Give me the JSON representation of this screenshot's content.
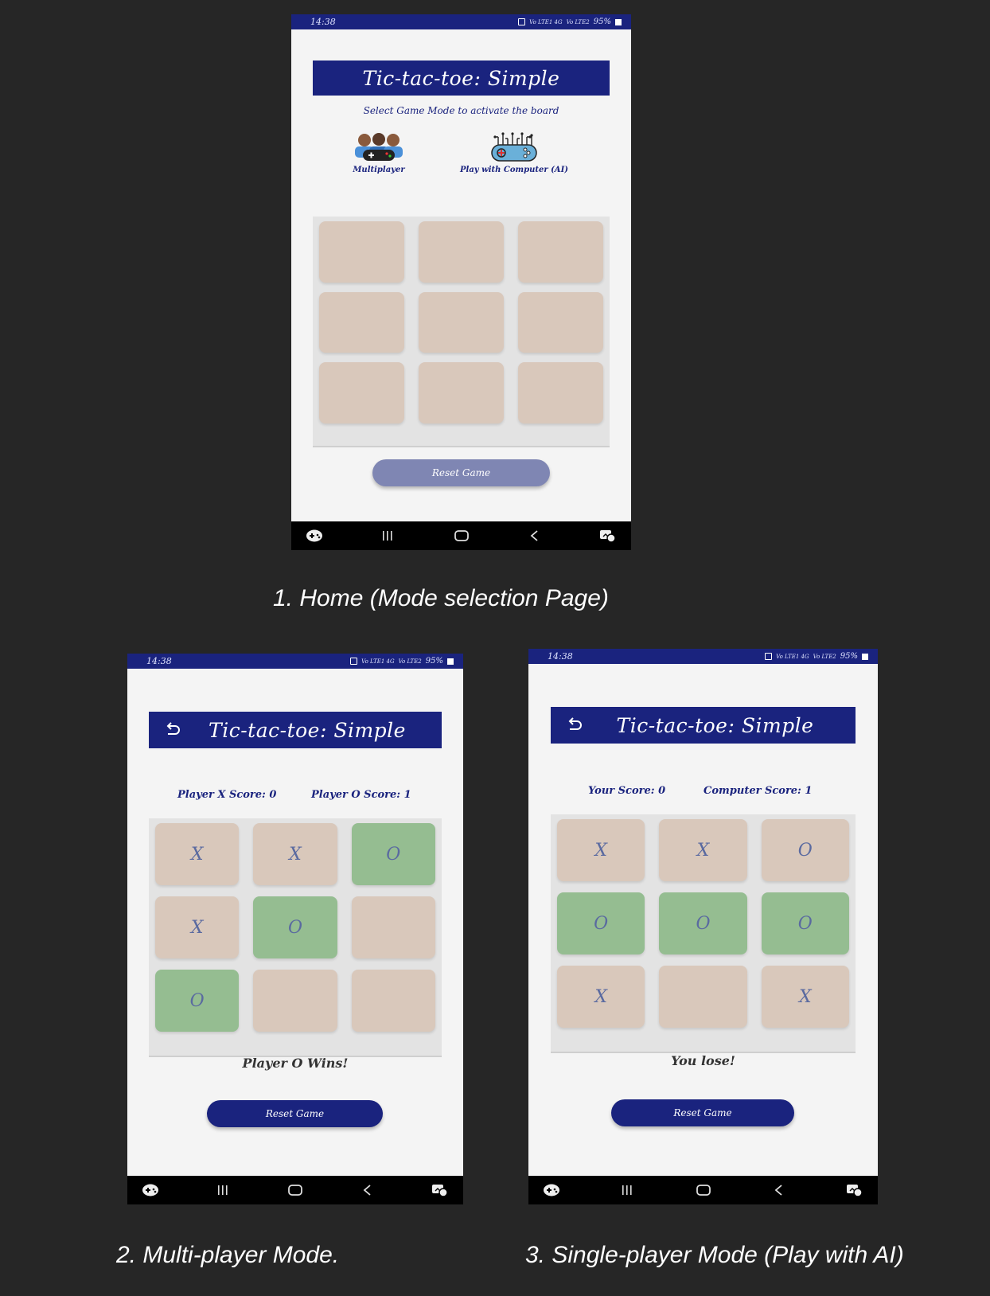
{
  "screens": [
    {
      "status": {
        "time": "14:38",
        "network": "Vo LTE1 4G",
        "network2": "Vo LTE2",
        "battery": "95%"
      },
      "title": "Tic-tac-toe: Simple",
      "subtitle": "Select Game Mode to activate the board",
      "modes": [
        {
          "label": "Multiplayer",
          "icon": "multiplayer-gamepad-icon"
        },
        {
          "label": "Play with Computer (AI)",
          "icon": "ai-gamepad-icon"
        }
      ],
      "board": [
        "",
        "",
        "",
        "",
        "",
        "",
        "",
        "",
        ""
      ],
      "reset_label": "Reset Game",
      "caption": "1.   Home (Mode selection Page)"
    },
    {
      "status": {
        "time": "14:38",
        "network": "Vo LTE1 4G",
        "network2": "Vo LTE2",
        "battery": "95%"
      },
      "title": "Tic-tac-toe: Simple",
      "scores": {
        "left": "Player X Score: 0",
        "right": "Player O Score: 1"
      },
      "board": [
        "X",
        "X",
        "O",
        "X",
        "O",
        "",
        "O",
        "",
        ""
      ],
      "winning_cells": [
        2,
        4,
        6
      ],
      "result": "Player O Wins!",
      "reset_label": "Reset Game",
      "caption": "2.   Multi-player Mode."
    },
    {
      "status": {
        "time": "14:38",
        "network": "Vo LTE1 4G",
        "network2": "Vo LTE2",
        "battery": "95%"
      },
      "title": "Tic-tac-toe: Simple",
      "scores": {
        "left": "Your Score: 0",
        "right": "Computer Score: 1"
      },
      "board": [
        "X",
        "X",
        "O",
        "O",
        "O",
        "O",
        "X",
        "",
        "X"
      ],
      "winning_cells": [
        3,
        4,
        5
      ],
      "result": "You lose!",
      "reset_label": "Reset Game",
      "caption": "3.   Single-player Mode (Play with AI)"
    }
  ],
  "colors": {
    "primary": "#1a237e",
    "cell": "#d9c8bb",
    "win_cell": "#95bd91",
    "reset_disabled": "#7f86b3",
    "background": "#262626"
  }
}
